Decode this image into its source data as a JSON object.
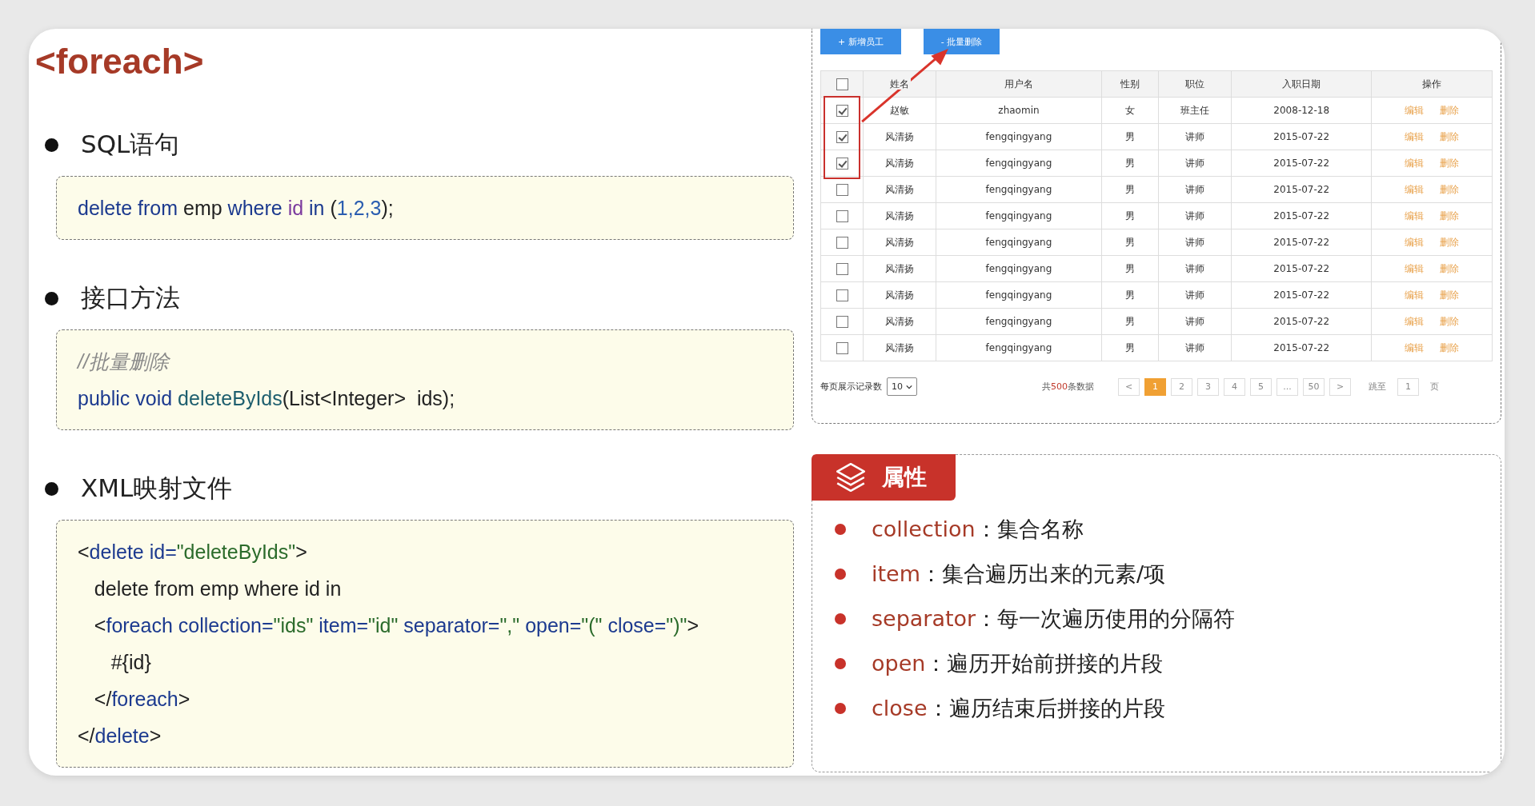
{
  "title": "<foreach>",
  "sections": [
    {
      "heading": "SQL语句",
      "code": [
        [
          {
            "kind": "kw",
            "text": "delete from"
          },
          {
            "kind": "plain",
            "text": " emp "
          },
          {
            "kind": "kw",
            "text": "where"
          },
          {
            "kind": "ident",
            "text": " id"
          },
          {
            "kind": "kw",
            "text": " in"
          },
          {
            "kind": "plain",
            "text": " ("
          },
          {
            "kind": "num",
            "text": "1,2,3"
          },
          {
            "kind": "plain",
            "text": ");"
          }
        ]
      ]
    },
    {
      "heading": "接口方法",
      "code": [
        [
          {
            "kind": "comment",
            "text": "//批量删除"
          }
        ],
        [
          {
            "kind": "kw",
            "text": "public void"
          },
          {
            "kind": "method",
            "text": " deleteByIds"
          },
          {
            "kind": "plain",
            "text": "(List<Integer>  ids);"
          }
        ]
      ]
    },
    {
      "heading": "XML映射文件",
      "code": [
        [
          {
            "kind": "plain",
            "text": "<"
          },
          {
            "kind": "kw",
            "text": "delete id="
          },
          {
            "kind": "str",
            "text": "\"deleteByIds\""
          },
          {
            "kind": "plain",
            "text": ">"
          }
        ],
        [
          {
            "kind": "plain",
            "text": "   delete from emp where id in"
          }
        ],
        [
          {
            "kind": "plain",
            "text": "   <"
          },
          {
            "kind": "kw",
            "text": "foreach collection="
          },
          {
            "kind": "str",
            "text": "\"ids\""
          },
          {
            "kind": "kw",
            "text": " item="
          },
          {
            "kind": "str",
            "text": "\"id\""
          },
          {
            "kind": "kw",
            "text": " separator="
          },
          {
            "kind": "str",
            "text": "\",\""
          },
          {
            "kind": "kw",
            "text": " open="
          },
          {
            "kind": "str",
            "text": "\"(\""
          },
          {
            "kind": "kw",
            "text": " close="
          },
          {
            "kind": "str",
            "text": "\")\""
          },
          {
            "kind": "plain",
            "text": ">"
          }
        ],
        [
          {
            "kind": "plain",
            "text": "      #{id}"
          }
        ],
        [
          {
            "kind": "plain",
            "text": "   </"
          },
          {
            "kind": "kw",
            "text": "foreach"
          },
          {
            "kind": "plain",
            "text": ">"
          }
        ],
        [
          {
            "kind": "plain",
            "text": "</"
          },
          {
            "kind": "kw",
            "text": "delete"
          },
          {
            "kind": "plain",
            "text": ">"
          }
        ]
      ]
    }
  ],
  "toolbar": [
    "+ 新增员工",
    "- 批量删除"
  ],
  "table": {
    "header_checked": false,
    "columns": [
      "姓名",
      "用户名",
      "性别",
      "职位",
      "入职日期",
      "操作"
    ],
    "rows": [
      {
        "checked": true,
        "cells": [
          "赵敏",
          "zhaomin",
          "女",
          "班主任",
          "2008-12-18"
        ],
        "actions": [
          "编辑",
          "删除"
        ]
      },
      {
        "checked": true,
        "cells": [
          "风清扬",
          "fengqingyang",
          "男",
          "讲师",
          "2015-07-22"
        ],
        "actions": [
          "编辑",
          "删除"
        ]
      },
      {
        "checked": true,
        "cells": [
          "风清扬",
          "fengqingyang",
          "男",
          "讲师",
          "2015-07-22"
        ],
        "actions": [
          "编辑",
          "删除"
        ]
      },
      {
        "checked": false,
        "cells": [
          "风清扬",
          "fengqingyang",
          "男",
          "讲师",
          "2015-07-22"
        ],
        "actions": [
          "编辑",
          "删除"
        ]
      },
      {
        "checked": false,
        "cells": [
          "风清扬",
          "fengqingyang",
          "男",
          "讲师",
          "2015-07-22"
        ],
        "actions": [
          "编辑",
          "删除"
        ]
      },
      {
        "checked": false,
        "cells": [
          "风清扬",
          "fengqingyang",
          "男",
          "讲师",
          "2015-07-22"
        ],
        "actions": [
          "编辑",
          "删除"
        ]
      },
      {
        "checked": false,
        "cells": [
          "风清扬",
          "fengqingyang",
          "男",
          "讲师",
          "2015-07-22"
        ],
        "actions": [
          "编辑",
          "删除"
        ]
      },
      {
        "checked": false,
        "cells": [
          "风清扬",
          "fengqingyang",
          "男",
          "讲师",
          "2015-07-22"
        ],
        "actions": [
          "编辑",
          "删除"
        ]
      },
      {
        "checked": false,
        "cells": [
          "风清扬",
          "fengqingyang",
          "男",
          "讲师",
          "2015-07-22"
        ],
        "actions": [
          "编辑",
          "删除"
        ]
      },
      {
        "checked": false,
        "cells": [
          "风清扬",
          "fengqingyang",
          "男",
          "讲师",
          "2015-07-22"
        ],
        "actions": [
          "编辑",
          "删除"
        ]
      }
    ]
  },
  "pagination": {
    "page_size_label": "每页展示记录数",
    "page_size": "10",
    "total": {
      "prefix": "共",
      "count": "500",
      "suffix": "条数据"
    },
    "pages": [
      {
        "label": "<",
        "selected": false
      },
      {
        "label": "1",
        "selected": true
      },
      {
        "label": "2",
        "selected": false
      },
      {
        "label": "3",
        "selected": false
      },
      {
        "label": "4",
        "selected": false
      },
      {
        "label": "5",
        "selected": false
      },
      {
        "label": "...",
        "selected": false
      },
      {
        "label": "50",
        "selected": false
      },
      {
        "label": ">",
        "selected": false
      }
    ],
    "jump_label": "跳至",
    "jump_value": "1",
    "jump_unit": "页"
  },
  "attributes": {
    "title": "属性",
    "items": [
      {
        "name": "collection",
        "desc": "：集合名称"
      },
      {
        "name": "item",
        "desc": "：集合遍历出来的元素/项"
      },
      {
        "name": "separator",
        "desc": "：每一次遍历使用的分隔符"
      },
      {
        "name": "open",
        "desc": "：遍历开始前拼接的片段"
      },
      {
        "name": "close",
        "desc": "：遍历结束后拼接的片段"
      }
    ]
  }
}
